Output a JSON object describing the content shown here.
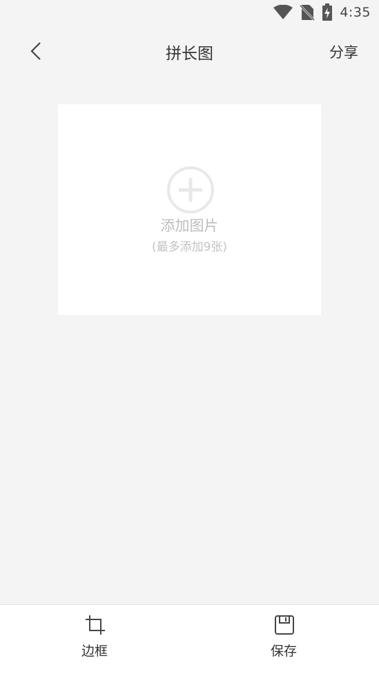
{
  "status_bar": {
    "time": "4:35",
    "icons": [
      "wifi-icon",
      "no-sim-icon",
      "battery-charging-icon"
    ]
  },
  "header": {
    "title": "拼长图",
    "share_label": "分享",
    "back_icon": "chevron-left-icon"
  },
  "add_card": {
    "icon": "plus-circle-icon",
    "label": "添加图片",
    "hint": "(最多添加9张)"
  },
  "toolbar": {
    "items": [
      {
        "label": "边框",
        "icon": "crop-icon"
      },
      {
        "label": "保存",
        "icon": "save-icon"
      }
    ]
  },
  "colors": {
    "background": "#f4f4f4",
    "card": "#ffffff",
    "placeholder_text": "#bdbdbd"
  }
}
